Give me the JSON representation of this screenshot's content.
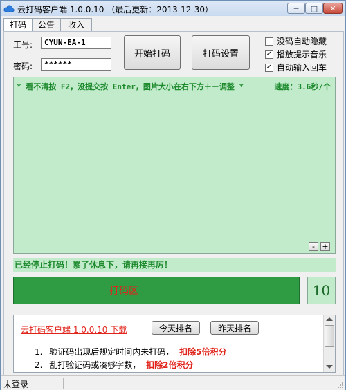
{
  "window": {
    "title": "云打码客户端 1.0.0.10 （最后更新：2013-12-30）",
    "min_glyph": "─",
    "max_glyph": "□",
    "close_glyph": "✕"
  },
  "tabs": [
    {
      "label": "打码",
      "active": true
    },
    {
      "label": "公告",
      "active": false
    },
    {
      "label": "收入",
      "active": false
    }
  ],
  "login": {
    "id_label": "工号:",
    "id_value": "CYUN-EA-1",
    "pwd_label": "密码:",
    "pwd_value": "******"
  },
  "buttons": {
    "start": "开始打码",
    "settings": "打码设置",
    "today_rank": "今天排名",
    "yesterday_rank": "昨天排名"
  },
  "options": [
    {
      "label": "没码自动隐藏",
      "checked": false
    },
    {
      "label": "播放提示音乐",
      "checked": true
    },
    {
      "label": "自动输入回车",
      "checked": true
    }
  ],
  "work_area": {
    "hint": "* 看不清按 F2，没提交按 Enter，图片大小在右下方＋－调整 *",
    "speed": "速度：3.6秒/个",
    "minus": "-",
    "plus": "+"
  },
  "status_message": "已经停止打码！累了休息下，请再接再厉！",
  "code_input": {
    "placeholder": "打码区",
    "counter": "10"
  },
  "notice": {
    "link": "云打码客户端 1.0.0.10 下载",
    "rules": [
      {
        "num": "1.",
        "text": "验证码出现后规定时间内未打码，",
        "penalty": "扣除5倍积分"
      },
      {
        "num": "2.",
        "text": "乱打验证码或凑够字数，",
        "penalty": "扣除2倍积分"
      }
    ]
  },
  "statusbar": {
    "text": "未登录"
  },
  "colors": {
    "accent_green": "#2f9b43",
    "light_green": "#c2ebcb",
    "text_green": "#1e8a2e",
    "warning_red": "#e0241b"
  }
}
